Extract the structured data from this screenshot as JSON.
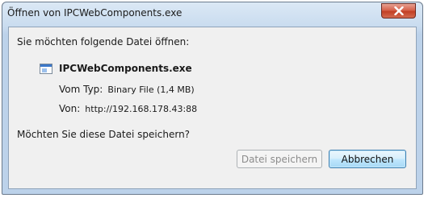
{
  "window": {
    "title": "Öffnen von IPCWebComponents.exe",
    "close_label": "X"
  },
  "dialog": {
    "intro": "Sie möchten folgende Datei öffnen:",
    "file_name": "IPCWebComponents.exe",
    "file_icon": "executable-file-icon",
    "type_label": "Vom Typ:",
    "type_value": "Binary File (1,4 MB)",
    "from_label": "Von:",
    "from_value": "http://192.168.178.43:88",
    "question": "Möchten Sie diese Datei speichern?"
  },
  "buttons": {
    "save_label": "Datei speichern",
    "cancel_label": "Abbrechen"
  },
  "colors": {
    "title_bar": "#c9dcef",
    "close_button": "#c94a30",
    "client_background": "#f0f0f0",
    "default_button_border": "#3c7fb1"
  }
}
